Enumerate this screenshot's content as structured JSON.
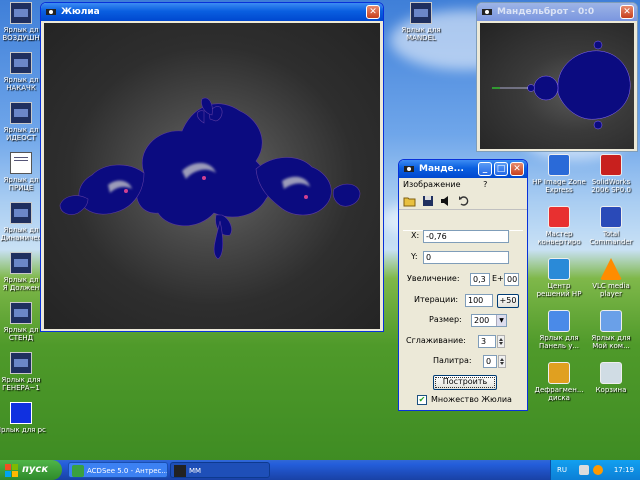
{
  "desktop": {
    "icons_left": [
      {
        "label": "Ярлык дл",
        "sub": "ВОЗДУШН",
        "icon": "program-icon"
      },
      {
        "label": "Ярлык дл",
        "sub": "НАКАЧК",
        "icon": "program-icon"
      },
      {
        "label": "Ярлык дл",
        "sub": "ИДЕОСТ",
        "icon": "program-icon"
      },
      {
        "label": "Ярлык дл",
        "sub": "ПРИЦЕ",
        "icon": "document-icon"
      },
      {
        "label": "Ярлык дл",
        "sub": "Динамичес",
        "icon": "program-icon"
      },
      {
        "label": "Ярлык дл",
        "sub": "Я Должен",
        "icon": "program-icon"
      },
      {
        "label": "Ярлык дл",
        "sub": "СТЕНД",
        "icon": "program-icon"
      },
      {
        "label": "Ярлык для",
        "sub": "ГЕНЕРА~1",
        "icon": "program-icon"
      },
      {
        "label": "Ярлык для рс",
        "sub": "",
        "icon": "blue-square-icon"
      }
    ],
    "icons_top": [
      {
        "label": "Ярлык для",
        "sub": "MANDEL",
        "icon": "program-icon"
      }
    ],
    "icons_right": [
      {
        "label": "HP Image Zone",
        "sub": "Express",
        "icon": "hp-icon"
      },
      {
        "label": "SolidWorks",
        "sub": "2006 SP0.0",
        "icon": "solidworks-icon"
      },
      {
        "label": "Мастер",
        "sub": "конвертиро",
        "icon": "pdf-icon"
      },
      {
        "label": "Total",
        "sub": "Commander",
        "icon": "total-commander-icon"
      },
      {
        "label": "Центр",
        "sub": "решений HP",
        "icon": "hp-center-icon"
      },
      {
        "label": "VLC media",
        "sub": "player",
        "icon": "vlc-icon"
      },
      {
        "label": "Ярлык для",
        "sub": "Панель у...",
        "icon": "control-panel-icon"
      },
      {
        "label": "Ярлык для",
        "sub": "Мой ком...",
        "icon": "computer-icon"
      },
      {
        "label": "Дефрагмен...",
        "sub": "диска",
        "icon": "defrag-icon"
      },
      {
        "label": "Корзина",
        "sub": "",
        "icon": "recycle-bin-icon"
      }
    ]
  },
  "julia_window": {
    "title": "Жюлиа",
    "close": "✕"
  },
  "mandel_window": {
    "title": "Мандельброт - 0:0",
    "close": "✕"
  },
  "control_window": {
    "title": "Манде...",
    "min": "_",
    "max": "□",
    "close": "✕",
    "menu": [
      "Изображение",
      "?"
    ],
    "toolbar": [
      "open-icon",
      "save-icon",
      "speaker-icon",
      "undo-icon"
    ],
    "x_label": "X:",
    "x_value": "-0,76",
    "y_label": "Y:",
    "y_value": "0",
    "zoom_label": "Увеличение:",
    "zoom_value": "0,3",
    "zoom_e": "E+",
    "zoom_exp": "00",
    "iter_label": "Итерации:",
    "iter_value": "100",
    "iter_btn": "+50",
    "size_label": "Размер:",
    "size_value": "200",
    "smooth_label": "Сглаживание:",
    "smooth_value": "3",
    "palette_label": "Палитра:",
    "palette_value": "0",
    "build_btn": "Построить",
    "julia_check_label": "Множество Жюлиа",
    "julia_checked": true
  },
  "taskbar": {
    "start": "пуск",
    "tasks": [
      {
        "label": "ACDSee 5.0 - Антрес...",
        "icon": "acdsee-icon"
      },
      {
        "label": "MM",
        "icon": "mm-icon"
      }
    ],
    "lang": "RU",
    "time": "17:19"
  },
  "colors": {
    "fractal": "#0a0a7a",
    "fractal_bg": "#2b2b2b",
    "xp_blue": "#0a5fe0"
  }
}
